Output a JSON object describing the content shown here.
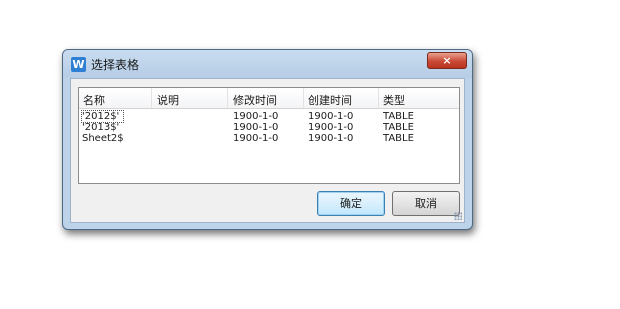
{
  "window": {
    "title": "选择表格",
    "app_icon": "wps-writer-icon",
    "close_glyph": "×"
  },
  "table": {
    "columns": [
      "名称",
      "说明",
      "修改时间",
      "创建时间",
      "类型"
    ],
    "rows": [
      [
        "'2012$'",
        "",
        "1900-1-0",
        "1900-1-0",
        "TABLE"
      ],
      [
        "'2013$'",
        "",
        "1900-1-0",
        "1900-1-0",
        "TABLE"
      ],
      [
        "Sheet2$",
        "",
        "1900-1-0",
        "1900-1-0",
        "TABLE"
      ]
    ]
  },
  "buttons": {
    "ok": "确定",
    "cancel": "取消"
  },
  "colors": {
    "frame": "#bcd3ea",
    "close": "#c94a36",
    "default_button": "#bee6fd",
    "client": "#f0f0f0"
  }
}
